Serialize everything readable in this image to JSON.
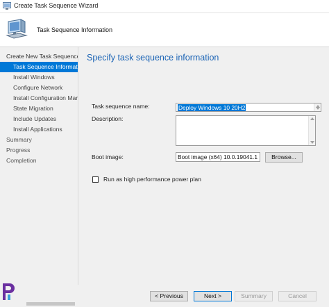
{
  "window": {
    "title": "Create Task Sequence Wizard"
  },
  "header": {
    "title": "Task Sequence Information"
  },
  "nav": {
    "items": [
      {
        "label": "Create New Task Sequence",
        "level": 0
      },
      {
        "label": "Task Sequence Informatio",
        "level": 1,
        "active": true
      },
      {
        "label": "Install Windows",
        "level": 1
      },
      {
        "label": "Configure Network",
        "level": 1
      },
      {
        "label": "Install Configuration Mar",
        "level": 1
      },
      {
        "label": "State Migration",
        "level": 1
      },
      {
        "label": "Include Updates",
        "level": 1
      },
      {
        "label": "Install Applications",
        "level": 1
      },
      {
        "label": "Summary",
        "level": 0
      },
      {
        "label": "Progress",
        "level": 0
      },
      {
        "label": "Completion",
        "level": 0
      }
    ]
  },
  "main": {
    "heading": "Specify task sequence information",
    "fields": {
      "name_label": "Task sequence name:",
      "name_value": "Deploy Windows 10 20H2",
      "description_label": "Description:",
      "description_value": "",
      "boot_label": "Boot image:",
      "boot_value": "Boot image (x64) 10.0.19041.1",
      "browse_label": "Browse..."
    },
    "checkbox": {
      "label": "Run as high performance power plan",
      "checked": false
    }
  },
  "footer": {
    "previous": "< Previous",
    "next": "Next >",
    "summary": "Summary",
    "cancel": "Cancel"
  },
  "colors": {
    "accent": "#0078d7",
    "heading": "#1a63b5"
  }
}
